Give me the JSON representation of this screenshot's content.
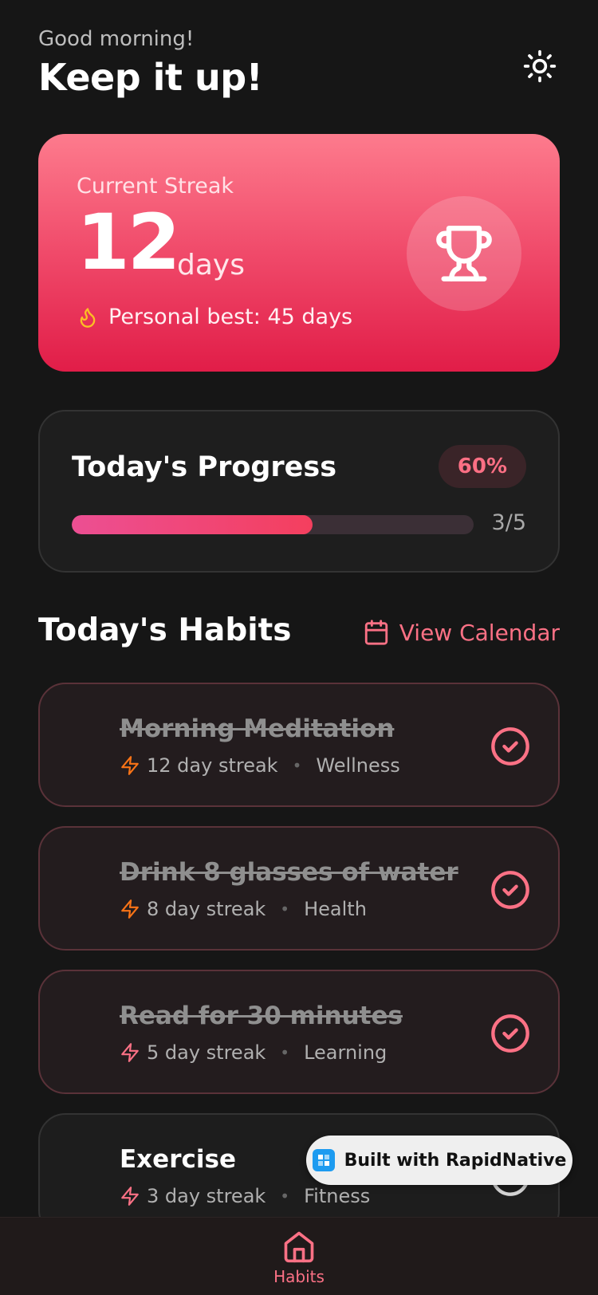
{
  "header": {
    "greeting": "Good morning!",
    "headline": "Keep it up!",
    "theme_icon": "sun-icon"
  },
  "streak": {
    "label": "Current Streak",
    "value": "12",
    "unit": "days",
    "best": "Personal best: 45 days",
    "icon": "trophy-icon"
  },
  "progress": {
    "title": "Today's Progress",
    "percent_label": "60%",
    "fraction": 0.6,
    "count": "3/5"
  },
  "habits_section": {
    "title": "Today's Habits",
    "view_calendar": "View Calendar"
  },
  "habits": [
    {
      "name": "Morning Meditation",
      "streak": "12 day streak",
      "category": "Wellness",
      "completed": true
    },
    {
      "name": "Drink 8 glasses of water",
      "streak": "8 day streak",
      "category": "Health",
      "completed": true
    },
    {
      "name": "Read for 30 minutes",
      "streak": "5 day streak",
      "category": "Learning",
      "completed": true
    },
    {
      "name": "Exercise",
      "streak": "3 day streak",
      "category": "Fitness",
      "completed": false
    }
  ],
  "badge": {
    "text": "Built with RapidNative"
  },
  "tabs": [
    {
      "label": "Habits",
      "icon": "home-icon",
      "active": true
    }
  ],
  "colors": {
    "accent": "#fb7185",
    "streak_gradient_top": "#fd7b8d",
    "streak_gradient_bottom": "#e11d48",
    "background": "#161616"
  }
}
